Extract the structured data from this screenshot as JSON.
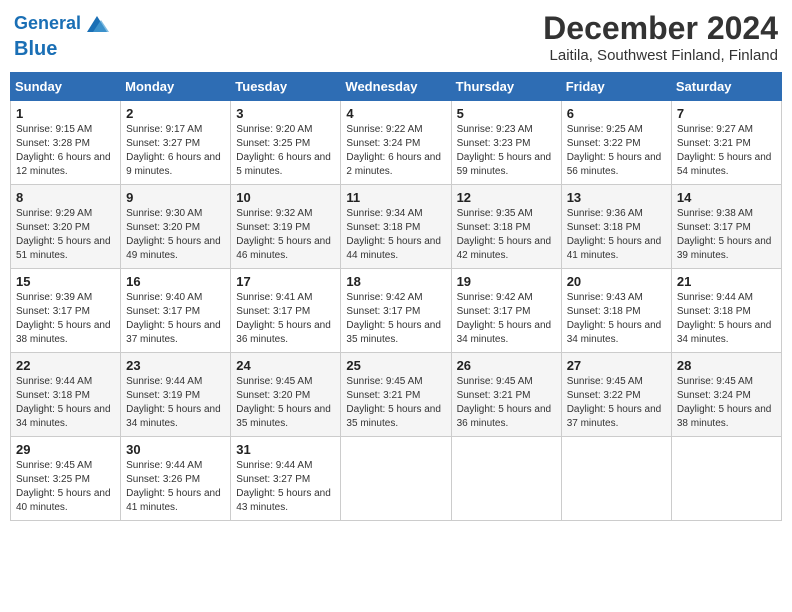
{
  "header": {
    "logo_line1": "General",
    "logo_line2": "Blue",
    "title": "December 2024",
    "subtitle": "Laitila, Southwest Finland, Finland"
  },
  "days_of_week": [
    "Sunday",
    "Monday",
    "Tuesday",
    "Wednesday",
    "Thursday",
    "Friday",
    "Saturday"
  ],
  "weeks": [
    [
      {
        "day": "1",
        "sunrise": "9:15 AM",
        "sunset": "3:28 PM",
        "daylight": "6 hours and 12 minutes."
      },
      {
        "day": "2",
        "sunrise": "9:17 AM",
        "sunset": "3:27 PM",
        "daylight": "6 hours and 9 minutes."
      },
      {
        "day": "3",
        "sunrise": "9:20 AM",
        "sunset": "3:25 PM",
        "daylight": "6 hours and 5 minutes."
      },
      {
        "day": "4",
        "sunrise": "9:22 AM",
        "sunset": "3:24 PM",
        "daylight": "6 hours and 2 minutes."
      },
      {
        "day": "5",
        "sunrise": "9:23 AM",
        "sunset": "3:23 PM",
        "daylight": "5 hours and 59 minutes."
      },
      {
        "day": "6",
        "sunrise": "9:25 AM",
        "sunset": "3:22 PM",
        "daylight": "5 hours and 56 minutes."
      },
      {
        "day": "7",
        "sunrise": "9:27 AM",
        "sunset": "3:21 PM",
        "daylight": "5 hours and 54 minutes."
      }
    ],
    [
      {
        "day": "8",
        "sunrise": "9:29 AM",
        "sunset": "3:20 PM",
        "daylight": "5 hours and 51 minutes."
      },
      {
        "day": "9",
        "sunrise": "9:30 AM",
        "sunset": "3:20 PM",
        "daylight": "5 hours and 49 minutes."
      },
      {
        "day": "10",
        "sunrise": "9:32 AM",
        "sunset": "3:19 PM",
        "daylight": "5 hours and 46 minutes."
      },
      {
        "day": "11",
        "sunrise": "9:34 AM",
        "sunset": "3:18 PM",
        "daylight": "5 hours and 44 minutes."
      },
      {
        "day": "12",
        "sunrise": "9:35 AM",
        "sunset": "3:18 PM",
        "daylight": "5 hours and 42 minutes."
      },
      {
        "day": "13",
        "sunrise": "9:36 AM",
        "sunset": "3:18 PM",
        "daylight": "5 hours and 41 minutes."
      },
      {
        "day": "14",
        "sunrise": "9:38 AM",
        "sunset": "3:17 PM",
        "daylight": "5 hours and 39 minutes."
      }
    ],
    [
      {
        "day": "15",
        "sunrise": "9:39 AM",
        "sunset": "3:17 PM",
        "daylight": "5 hours and 38 minutes."
      },
      {
        "day": "16",
        "sunrise": "9:40 AM",
        "sunset": "3:17 PM",
        "daylight": "5 hours and 37 minutes."
      },
      {
        "day": "17",
        "sunrise": "9:41 AM",
        "sunset": "3:17 PM",
        "daylight": "5 hours and 36 minutes."
      },
      {
        "day": "18",
        "sunrise": "9:42 AM",
        "sunset": "3:17 PM",
        "daylight": "5 hours and 35 minutes."
      },
      {
        "day": "19",
        "sunrise": "9:42 AM",
        "sunset": "3:17 PM",
        "daylight": "5 hours and 34 minutes."
      },
      {
        "day": "20",
        "sunrise": "9:43 AM",
        "sunset": "3:18 PM",
        "daylight": "5 hours and 34 minutes."
      },
      {
        "day": "21",
        "sunrise": "9:44 AM",
        "sunset": "3:18 PM",
        "daylight": "5 hours and 34 minutes."
      }
    ],
    [
      {
        "day": "22",
        "sunrise": "9:44 AM",
        "sunset": "3:18 PM",
        "daylight": "5 hours and 34 minutes."
      },
      {
        "day": "23",
        "sunrise": "9:44 AM",
        "sunset": "3:19 PM",
        "daylight": "5 hours and 34 minutes."
      },
      {
        "day": "24",
        "sunrise": "9:45 AM",
        "sunset": "3:20 PM",
        "daylight": "5 hours and 35 minutes."
      },
      {
        "day": "25",
        "sunrise": "9:45 AM",
        "sunset": "3:21 PM",
        "daylight": "5 hours and 35 minutes."
      },
      {
        "day": "26",
        "sunrise": "9:45 AM",
        "sunset": "3:21 PM",
        "daylight": "5 hours and 36 minutes."
      },
      {
        "day": "27",
        "sunrise": "9:45 AM",
        "sunset": "3:22 PM",
        "daylight": "5 hours and 37 minutes."
      },
      {
        "day": "28",
        "sunrise": "9:45 AM",
        "sunset": "3:24 PM",
        "daylight": "5 hours and 38 minutes."
      }
    ],
    [
      {
        "day": "29",
        "sunrise": "9:45 AM",
        "sunset": "3:25 PM",
        "daylight": "5 hours and 40 minutes."
      },
      {
        "day": "30",
        "sunrise": "9:44 AM",
        "sunset": "3:26 PM",
        "daylight": "5 hours and 41 minutes."
      },
      {
        "day": "31",
        "sunrise": "9:44 AM",
        "sunset": "3:27 PM",
        "daylight": "5 hours and 43 minutes."
      },
      null,
      null,
      null,
      null
    ]
  ]
}
